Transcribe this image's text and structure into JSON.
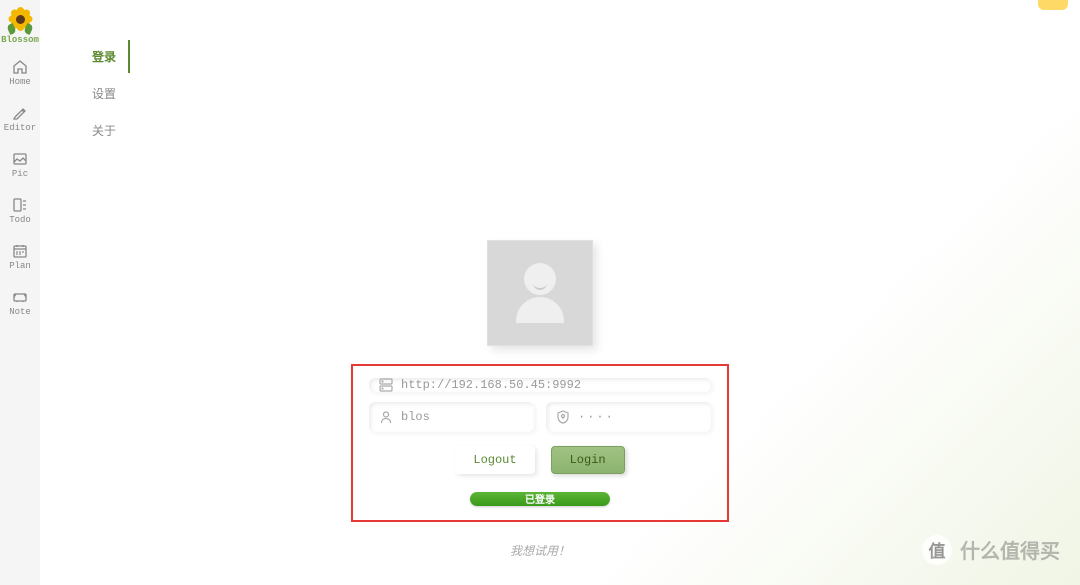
{
  "app": {
    "name": "Blossom"
  },
  "sidebar": {
    "items": [
      {
        "label": "Home",
        "icon": "home"
      },
      {
        "label": "Editor",
        "icon": "editor"
      },
      {
        "label": "Pic",
        "icon": "pic"
      },
      {
        "label": "Todo",
        "icon": "todo"
      },
      {
        "label": "Plan",
        "icon": "plan"
      },
      {
        "label": "Note",
        "icon": "note"
      }
    ]
  },
  "menu": {
    "items": [
      {
        "label": "登录",
        "active": true
      },
      {
        "label": "设置",
        "active": false
      },
      {
        "label": "关于",
        "active": false
      }
    ]
  },
  "login": {
    "server_url": "http://192.168.50.45:9992",
    "username": "blos",
    "password_display": "····",
    "logout_label": "Logout",
    "login_label": "Login",
    "status_text": "已登录"
  },
  "footer": {
    "trial_text": "我想试用！"
  },
  "watermark": {
    "logo": "值",
    "text": "什么值得买"
  }
}
